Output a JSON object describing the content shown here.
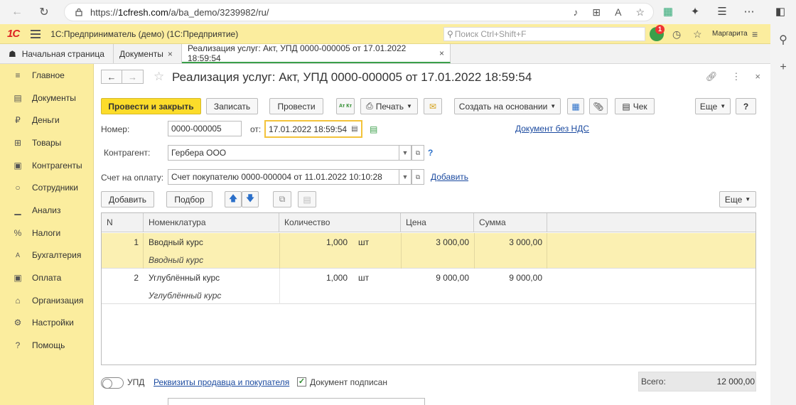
{
  "browser": {
    "url_prefix": "https://",
    "url_host": "1cfresh.com",
    "url_path": "/a/ba_demo/3239982/ru/"
  },
  "header": {
    "logo": "1С",
    "title": "1С:Предприниматель (демо)  (1С:Предприятие)",
    "search_placeholder": "Поиск Ctrl+Shift+F",
    "notification_count": "1",
    "user": "Маргарита"
  },
  "tabs": [
    {
      "label": "Начальная страница"
    },
    {
      "label": "Документы"
    },
    {
      "label": "Реализация услуг: Акт, УПД 0000-000005 от 17.01.2022 18:59:54"
    }
  ],
  "sidebar": {
    "items": [
      {
        "label": "Главное",
        "icon": "menu-icon"
      },
      {
        "label": "Документы",
        "icon": "document-icon"
      },
      {
        "label": "Деньги",
        "icon": "ruble-icon"
      },
      {
        "label": "Товары",
        "icon": "grid-icon"
      },
      {
        "label": "Контрагенты",
        "icon": "briefcase-icon"
      },
      {
        "label": "Сотрудники",
        "icon": "person-icon"
      },
      {
        "label": "Анализ",
        "icon": "bar-chart-icon"
      },
      {
        "label": "Налоги",
        "icon": "percent-icon"
      },
      {
        "label": "Бухгалтерия",
        "icon": "accounting-icon"
      },
      {
        "label": "Оплата",
        "icon": "wallet-icon"
      },
      {
        "label": "Организация",
        "icon": "house-icon"
      },
      {
        "label": "Настройки",
        "icon": "gear-icon"
      },
      {
        "label": "Помощь",
        "icon": "question-icon"
      }
    ]
  },
  "form": {
    "title": "Реализация услуг: Акт, УПД 0000-000005 от 17.01.2022 18:59:54",
    "toolbar": {
      "post_close": "Провести и закрыть",
      "save": "Записать",
      "post": "Провести",
      "dtkt": "Ат Кт",
      "print": "Печать",
      "create_based": "Создать на основании",
      "check": "Чек",
      "more": "Еще",
      "help": "?"
    },
    "number_label": "Номер:",
    "number_value": "0000-000005",
    "date_label": "от:",
    "date_value": "17.01.2022 18:59:54",
    "vat_link": "Документ без НДС",
    "counterparty_label": "Контрагент:",
    "counterparty_value": "Гербера ООО",
    "invoice_label": "Счет на оплату:",
    "invoice_value": "Счет покупателю 0000-000004 от 11.01.2022 10:10:28",
    "add_link": "Добавить",
    "table_toolbar": {
      "add": "Добавить",
      "select": "Подбор",
      "more": "Еще"
    }
  },
  "table": {
    "columns": [
      "N",
      "Номенклатура",
      "Количество",
      "Цена",
      "Сумма"
    ],
    "rows": [
      {
        "n": "1",
        "name": "Вводный курс",
        "desc": "Вводный курс",
        "qty": "1,000",
        "unit": "шт",
        "price": "3 000,00",
        "sum": "3 000,00"
      },
      {
        "n": "2",
        "name": "Углублённый курс",
        "desc": "Углублённый курс",
        "qty": "1,000",
        "unit": "шт",
        "price": "9 000,00",
        "sum": "9 000,00"
      }
    ]
  },
  "footer": {
    "upd_label": "УПД",
    "requisites_link": "Реквизиты продавца и покупателя",
    "signed_label": "Документ подписан",
    "total_label": "Всего:",
    "total_value": "12 000,00"
  }
}
